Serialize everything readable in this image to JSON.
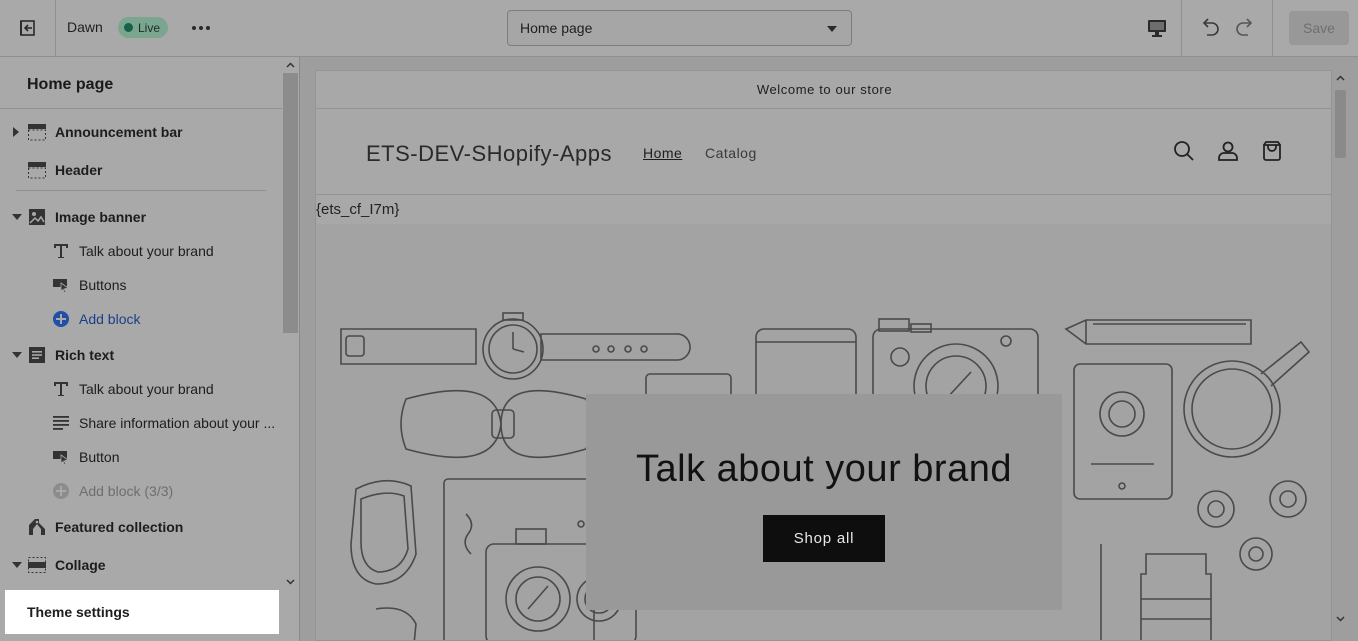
{
  "topbar": {
    "theme_name": "Dawn",
    "live_badge": "Live",
    "page_select": "Home page",
    "save_label": "Save",
    "icons": [
      "exit-icon",
      "more-icon",
      "desktop-icon",
      "undo-icon",
      "redo-icon"
    ]
  },
  "sidebar": {
    "title": "Home page",
    "sections": [
      {
        "label": "Announcement bar",
        "icon": "announcement-bar-icon",
        "expand": "collapsed"
      },
      {
        "label": "Header",
        "icon": "header-icon"
      },
      {
        "label": "Image banner",
        "icon": "image-icon",
        "expand": "expanded"
      },
      {
        "label": "Talk about your brand",
        "icon": "text-icon"
      },
      {
        "label": "Buttons",
        "icon": "button-icon"
      },
      {
        "label": "Add block",
        "icon": "add-icon"
      },
      {
        "label": "Rich text",
        "icon": "rich-text-icon",
        "expand": "expanded"
      },
      {
        "label": "Talk about your brand",
        "icon": "text-icon"
      },
      {
        "label": "Share information about your ...",
        "icon": "paragraph-icon"
      },
      {
        "label": "Button",
        "icon": "button-icon"
      },
      {
        "label": "Add block (3/3)",
        "icon": "add-icon-disabled"
      },
      {
        "label": "Featured collection",
        "icon": "tag-icon"
      },
      {
        "label": "Collage",
        "icon": "collage-icon",
        "expand": "expanded"
      }
    ],
    "footer": "Theme settings"
  },
  "preview": {
    "announcement": "Welcome to our store",
    "store_name": "ETS-DEV-SHopify-Apps",
    "nav": [
      "Home",
      "Catalog"
    ],
    "shortcode": "{ets_cf_I7m}",
    "banner_heading": "Talk about your brand",
    "banner_button": "Shop all",
    "header_icons": [
      "search-icon",
      "account-icon",
      "cart-icon"
    ]
  }
}
